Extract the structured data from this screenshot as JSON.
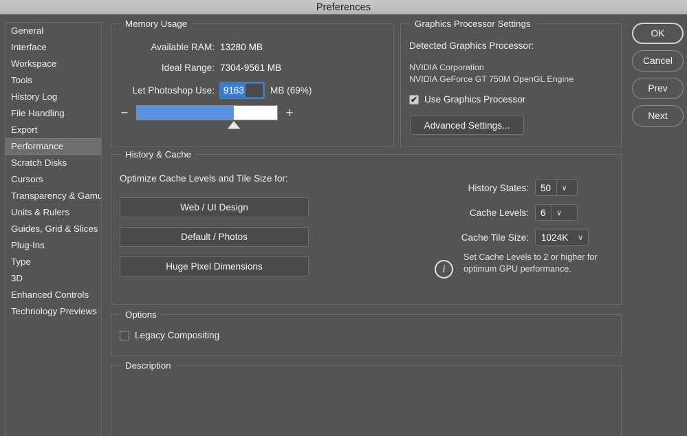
{
  "window": {
    "title": "Preferences"
  },
  "sidebar": {
    "items": [
      {
        "label": "General",
        "selected": false
      },
      {
        "label": "Interface",
        "selected": false
      },
      {
        "label": "Workspace",
        "selected": false
      },
      {
        "label": "Tools",
        "selected": false
      },
      {
        "label": "History Log",
        "selected": false
      },
      {
        "label": "File Handling",
        "selected": false
      },
      {
        "label": "Export",
        "selected": false
      },
      {
        "label": "Performance",
        "selected": true
      },
      {
        "label": "Scratch Disks",
        "selected": false
      },
      {
        "label": "Cursors",
        "selected": false
      },
      {
        "label": "Transparency & Gamut",
        "selected": false
      },
      {
        "label": "Units & Rulers",
        "selected": false
      },
      {
        "label": "Guides, Grid & Slices",
        "selected": false
      },
      {
        "label": "Plug-Ins",
        "selected": false
      },
      {
        "label": "Type",
        "selected": false
      },
      {
        "label": "3D",
        "selected": false
      },
      {
        "label": "Enhanced Controls",
        "selected": false
      },
      {
        "label": "Technology Previews",
        "selected": false
      }
    ]
  },
  "memory_usage": {
    "legend": "Memory Usage",
    "available_ram_label": "Available RAM:",
    "available_ram_value": "13280 MB",
    "ideal_range_label": "Ideal Range:",
    "ideal_range_value": "7304-9561 MB",
    "let_photoshop_use_label": "Let Photoshop Use:",
    "let_photoshop_use_value": "9163",
    "let_photoshop_use_suffix": "MB (69%)",
    "slider_percent": 69,
    "decrease_icon": "minus-icon",
    "increase_icon": "plus-icon",
    "accent_color": "#5b92e0",
    "selection_color": "#3b7fd4"
  },
  "graphics_processor": {
    "legend": "Graphics Processor Settings",
    "detected_label": "Detected Graphics Processor:",
    "vendor": "NVIDIA Corporation",
    "model": "NVIDIA GeForce GT 750M OpenGL Engine",
    "use_gpu_label": "Use Graphics Processor",
    "use_gpu_checked": true,
    "check_glyph": "✔",
    "advanced_settings_label": "Advanced Settings..."
  },
  "history_cache": {
    "legend": "History & Cache",
    "optimize_label": "Optimize Cache Levels and Tile Size for:",
    "presets": [
      {
        "label": "Web / UI Design"
      },
      {
        "label": "Default / Photos"
      },
      {
        "label": "Huge Pixel Dimensions"
      }
    ],
    "history_states_label": "History States:",
    "history_states_value": "50",
    "cache_levels_label": "Cache Levels:",
    "cache_levels_value": "6",
    "cache_tile_size_label": "Cache Tile Size:",
    "cache_tile_size_value": "1024K",
    "chevron_glyph": "∨",
    "hint_icon": "info-icon",
    "hint_glyph": "i",
    "hint_text": "Set Cache Levels to 2 or higher for optimum GPU performance."
  },
  "options": {
    "legend": "Options",
    "legacy_compositing_label": "Legacy Compositing",
    "legacy_compositing_checked": false
  },
  "description": {
    "legend": "Description",
    "text": ""
  },
  "buttons": {
    "ok": "OK",
    "cancel": "Cancel",
    "prev": "Prev",
    "next": "Next"
  }
}
